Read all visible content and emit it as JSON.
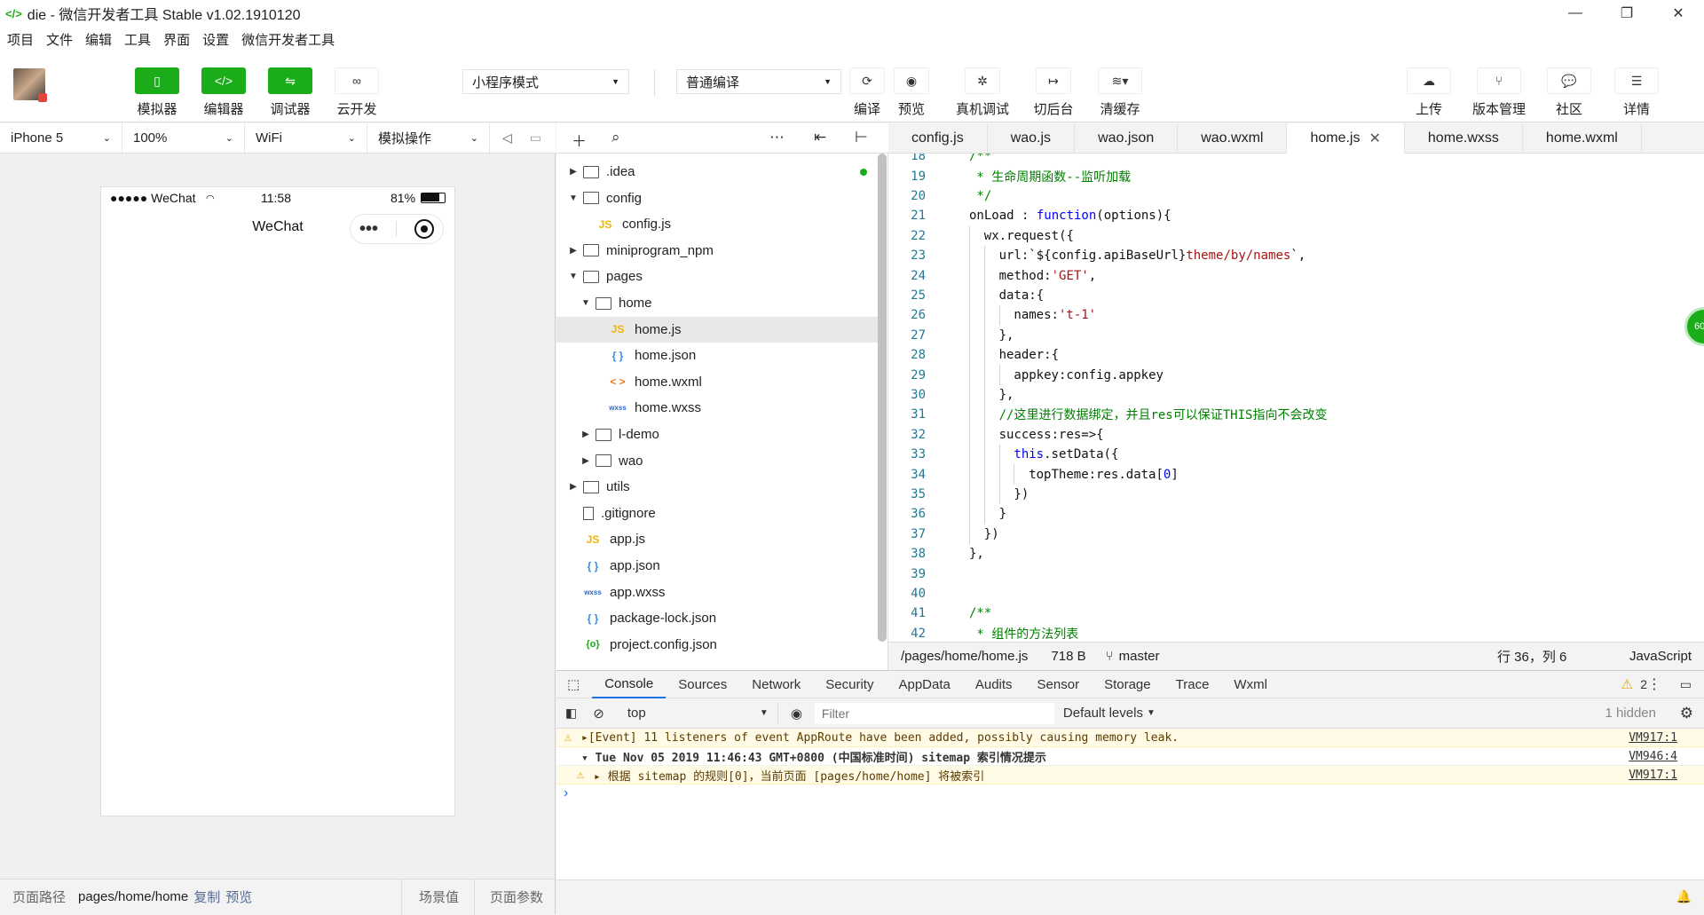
{
  "window": {
    "title": "die - 微信开发者工具 Stable v1.02.1910120",
    "logo": "</>",
    "controls": [
      "—",
      "❐",
      "✕"
    ]
  },
  "menu": [
    "项目",
    "文件",
    "编辑",
    "工具",
    "界面",
    "设置",
    "微信开发者工具"
  ],
  "toolbar": {
    "simulator": "模拟器",
    "editor": "编辑器",
    "debugger": "调试器",
    "cloud": "云开发",
    "mode_select": "小程序模式",
    "compile_select": "普通编译",
    "compile": "编译",
    "preview": "预览",
    "remote_debug": "真机调试",
    "background": "切后台",
    "clear_cache": "清缓存",
    "upload": "上传",
    "version": "版本管理",
    "community": "社区",
    "details": "详情"
  },
  "sim_controls": {
    "device": "iPhone 5",
    "zoom": "100%",
    "network": "WiFi",
    "operation": "模拟操作"
  },
  "phone": {
    "signal": "●●●●● WeChat",
    "time": "11:58",
    "battery": "81%",
    "nav_title": "WeChat",
    "capsule_dots": "•••"
  },
  "sim_footer": {
    "path_label": "页面路径",
    "path": "pages/home/home",
    "copy": "复制",
    "preview": "预览",
    "scene": "场景值",
    "params": "页面参数"
  },
  "tree": [
    {
      "name": ".idea",
      "type": "folder",
      "depth": 0,
      "open": false,
      "git": true
    },
    {
      "name": "config",
      "type": "folder",
      "depth": 0,
      "open": true
    },
    {
      "name": "config.js",
      "type": "js",
      "depth": 1
    },
    {
      "name": "miniprogram_npm",
      "type": "folder",
      "depth": 0,
      "open": false
    },
    {
      "name": "pages",
      "type": "folder",
      "depth": 0,
      "open": true
    },
    {
      "name": "home",
      "type": "folder",
      "depth": 1,
      "open": true
    },
    {
      "name": "home.js",
      "type": "js",
      "depth": 2,
      "selected": true
    },
    {
      "name": "home.json",
      "type": "json",
      "depth": 2
    },
    {
      "name": "home.wxml",
      "type": "wxml",
      "depth": 2
    },
    {
      "name": "home.wxss",
      "type": "wxss",
      "depth": 2
    },
    {
      "name": "l-demo",
      "type": "folder",
      "depth": 1,
      "open": false
    },
    {
      "name": "wao",
      "type": "folder",
      "depth": 1,
      "open": false
    },
    {
      "name": "utils",
      "type": "folder",
      "depth": 0,
      "open": false
    },
    {
      "name": ".gitignore",
      "type": "file",
      "depth": 0
    },
    {
      "name": "app.js",
      "type": "js",
      "depth": 0
    },
    {
      "name": "app.json",
      "type": "json",
      "depth": 0
    },
    {
      "name": "app.wxss",
      "type": "wxss",
      "depth": 0
    },
    {
      "name": "package-lock.json",
      "type": "json",
      "depth": 0
    },
    {
      "name": "project.config.json",
      "type": "cfg",
      "depth": 0
    }
  ],
  "icons": {
    "js": "JS",
    "json": "{ }",
    "wxml": "< >",
    "wxss": "wxss",
    "cfg": "{o}"
  },
  "tabs": [
    {
      "label": "config.js",
      "active": false
    },
    {
      "label": "wao.js",
      "active": false
    },
    {
      "label": "wao.json",
      "active": false
    },
    {
      "label": "wao.wxml",
      "active": false
    },
    {
      "label": "home.js",
      "active": true
    },
    {
      "label": "home.wxss",
      "active": false
    },
    {
      "label": "home.wxml",
      "active": false
    }
  ],
  "code": [
    {
      "n": "18",
      "i": 0,
      "seg": [
        [
          "c",
          "/**"
        ]
      ]
    },
    {
      "n": "19",
      "i": 0,
      "seg": [
        [
          "c",
          " * 生命周期函数--监听加载"
        ]
      ]
    },
    {
      "n": "20",
      "i": 0,
      "seg": [
        [
          "c",
          " */"
        ]
      ]
    },
    {
      "n": "21",
      "i": 0,
      "seg": [
        [
          "",
          "onLoad : "
        ],
        [
          "k",
          "function"
        ],
        [
          "",
          "(options){"
        ]
      ]
    },
    {
      "n": "22",
      "i": 1,
      "seg": [
        [
          "",
          "wx.request({"
        ]
      ]
    },
    {
      "n": "23",
      "i": 2,
      "seg": [
        [
          "",
          "url:`${config.apiBaseUrl}"
        ],
        [
          "s",
          "theme/by/names"
        ],
        [
          "",
          "`,"
        ]
      ]
    },
    {
      "n": "24",
      "i": 2,
      "seg": [
        [
          "",
          "method:"
        ],
        [
          "s",
          "'GET'"
        ],
        [
          "",
          ","
        ]
      ]
    },
    {
      "n": "25",
      "i": 2,
      "seg": [
        [
          "",
          "data:{"
        ]
      ]
    },
    {
      "n": "26",
      "i": 3,
      "seg": [
        [
          "",
          "names:"
        ],
        [
          "s",
          "'t-1'"
        ]
      ]
    },
    {
      "n": "27",
      "i": 2,
      "seg": [
        [
          "",
          "},"
        ]
      ]
    },
    {
      "n": "28",
      "i": 2,
      "seg": [
        [
          "",
          "header:{"
        ]
      ]
    },
    {
      "n": "29",
      "i": 3,
      "seg": [
        [
          "",
          "appkey:config.appkey"
        ]
      ]
    },
    {
      "n": "30",
      "i": 2,
      "seg": [
        [
          "",
          "},"
        ]
      ]
    },
    {
      "n": "31",
      "i": 2,
      "seg": [
        [
          "c",
          "//这里进行数据绑定，并且res可以保证THIS指向不会改变"
        ]
      ]
    },
    {
      "n": "32",
      "i": 2,
      "seg": [
        [
          "",
          "success:res=>{"
        ]
      ]
    },
    {
      "n": "33",
      "i": 3,
      "seg": [
        [
          "k",
          "this"
        ],
        [
          "",
          ".setData({"
        ]
      ]
    },
    {
      "n": "34",
      "i": 4,
      "seg": [
        [
          "",
          "topTheme:res.data["
        ],
        [
          "t",
          "0"
        ],
        [
          "",
          "]"
        ]
      ]
    },
    {
      "n": "35",
      "i": 3,
      "seg": [
        [
          "",
          "})"
        ]
      ]
    },
    {
      "n": "36",
      "i": 2,
      "seg": [
        [
          "",
          "}"
        ]
      ]
    },
    {
      "n": "37",
      "i": 1,
      "seg": [
        [
          "",
          "})"
        ]
      ]
    },
    {
      "n": "38",
      "i": 0,
      "seg": [
        [
          "",
          "},"
        ]
      ]
    },
    {
      "n": "39",
      "i": 0,
      "seg": []
    },
    {
      "n": "40",
      "i": 0,
      "seg": []
    },
    {
      "n": "41",
      "i": 0,
      "seg": [
        [
          "c",
          "/**"
        ]
      ]
    },
    {
      "n": "42",
      "i": 0,
      "seg": [
        [
          "c",
          " * 组件的方法列表"
        ]
      ]
    }
  ],
  "minimap_badge": "60",
  "editor_status": {
    "path": "/pages/home/home.js",
    "size": "718 B",
    "branch": "master",
    "position": "行 36，列 6",
    "language": "JavaScript"
  },
  "devtools": {
    "tabs": [
      "Console",
      "Sources",
      "Network",
      "Security",
      "AppData",
      "Audits",
      "Sensor",
      "Storage",
      "Trace",
      "Wxml"
    ],
    "warn_count": "2",
    "context": "top",
    "filter_placeholder": "Filter",
    "levels": "Default levels",
    "hidden": "1 hidden"
  },
  "console": [
    {
      "kind": "warn",
      "text": "▸[Event] 11 listeners of event AppRoute have been added, possibly causing memory leak.",
      "src": "VM917:1"
    },
    {
      "kind": "group",
      "text": "▾ Tue Nov 05 2019 11:46:43 GMT+0800 (中国标准时间) sitemap 索引情况提示",
      "src": "VM946:4"
    },
    {
      "kind": "warn",
      "text": "▸ 根据 sitemap 的规则[0]，当前页面 [pages/home/home] 将被索引",
      "src": "VM917:1"
    }
  ],
  "prompt": "›"
}
